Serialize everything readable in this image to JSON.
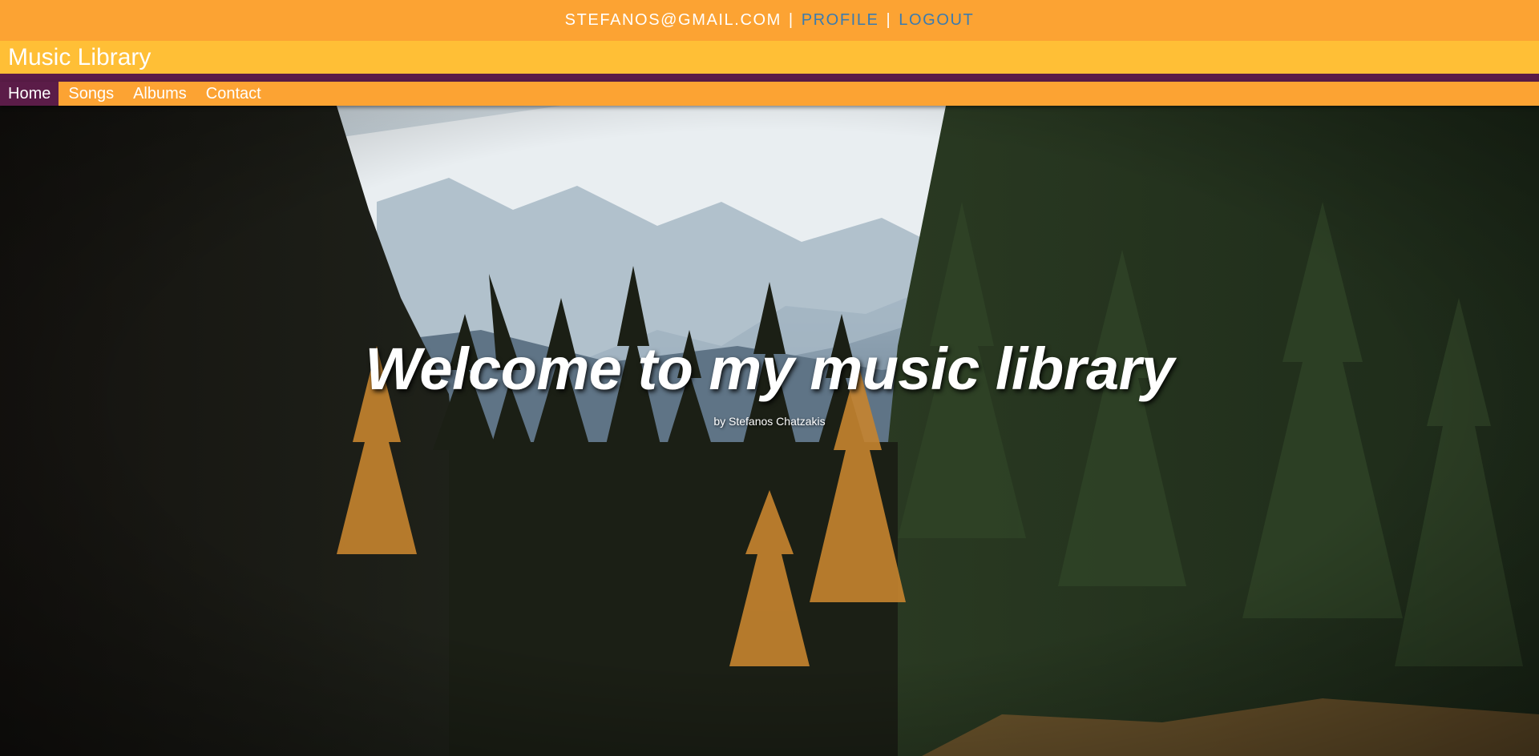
{
  "topbar": {
    "email": "STEFANOS@GMAIL.COM",
    "separator": "|",
    "profile": "PROFILE",
    "logout": "LOGOUT"
  },
  "site": {
    "title": "Music Library"
  },
  "nav": {
    "items": [
      {
        "label": "Home",
        "active": true
      },
      {
        "label": "Songs"
      },
      {
        "label": "Albums"
      },
      {
        "label": "Contact"
      }
    ]
  },
  "hero": {
    "title": "Welcome to my music library",
    "subtitle": "by Stefanos Chatzakis",
    "image": "forest-mountain-background"
  },
  "colors": {
    "topbar": "#fca333",
    "titlebar": "#ffbf36",
    "accent": "#5b1c48",
    "link": "#3a7bb0"
  }
}
